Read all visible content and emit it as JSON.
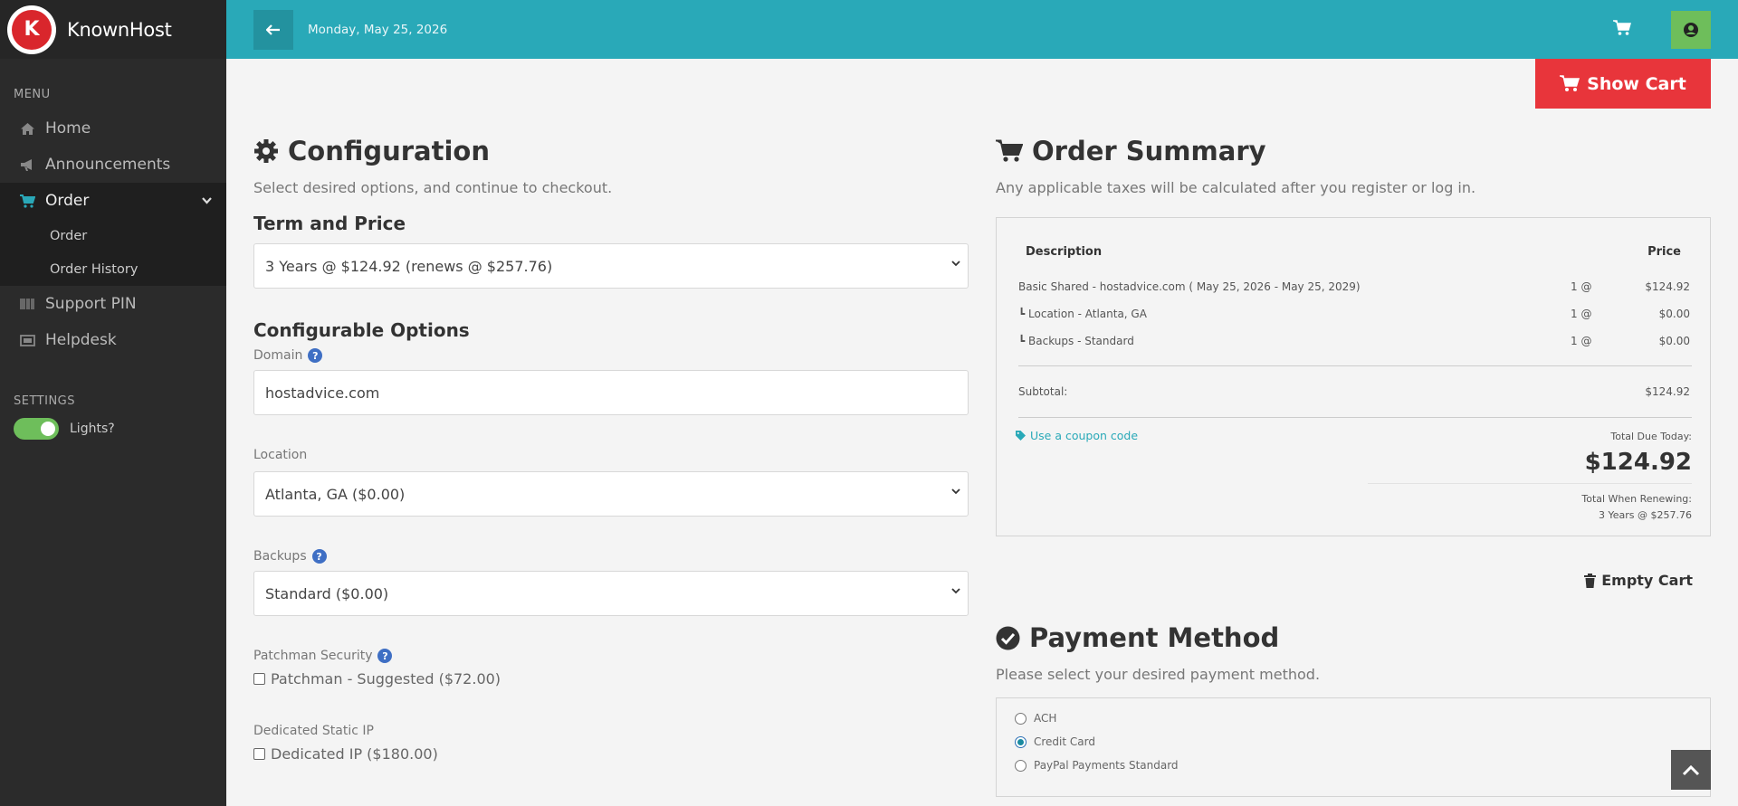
{
  "brand": {
    "name": "KnownHost"
  },
  "sidebar": {
    "menu_label": "MENU",
    "items": [
      {
        "label": "Home",
        "icon": "home-icon"
      },
      {
        "label": "Announcements",
        "icon": "bullhorn-icon"
      },
      {
        "label": "Order",
        "icon": "cart-icon"
      },
      {
        "label": "Support PIN",
        "icon": "barcode-icon"
      },
      {
        "label": "Helpdesk",
        "icon": "ticket-icon"
      }
    ],
    "sub_items": [
      {
        "label": "Order"
      },
      {
        "label": "Order History"
      }
    ],
    "settings_label": "SETTINGS",
    "lights_label": "Lights?"
  },
  "topbar": {
    "date": "Monday, May 25, 2026"
  },
  "show_cart": {
    "label": "Show Cart"
  },
  "config": {
    "title": "Configuration",
    "subtitle": "Select desired options, and continue to checkout.",
    "term_title": "Term and Price",
    "term_value": "3 Years @ $124.92 (renews @ $257.76)",
    "options_title": "Configurable Options",
    "domain_label": "Domain",
    "domain_value": "hostadvice.com",
    "location_label": "Location",
    "location_value": "Atlanta, GA ($0.00)",
    "backups_label": "Backups",
    "backups_value": "Standard ($0.00)",
    "patchman_label": "Patchman Security",
    "patchman_option": "Patchman - Suggested ($72.00)",
    "static_ip_label": "Dedicated Static IP",
    "static_ip_option": "Dedicated IP ($180.00)"
  },
  "summary": {
    "title": "Order Summary",
    "subtitle": "Any applicable taxes will be calculated after you register or log in.",
    "col_description": "Description",
    "col_price": "Price",
    "lines": [
      {
        "desc": "Basic Shared - hostadvice.com ( May 25, 2026 - May 25, 2029)",
        "qty": "1 @",
        "price": "$124.92"
      },
      {
        "desc": "┗ Location - Atlanta, GA",
        "qty": "1 @",
        "price": "$0.00"
      },
      {
        "desc": "┗ Backups - Standard",
        "qty": "1 @",
        "price": "$0.00"
      }
    ],
    "subtotal_label": "Subtotal:",
    "subtotal_value": "$124.92",
    "coupon_label": "Use a coupon code",
    "total_due_label": "Total Due Today:",
    "total_due_value": "$124.92",
    "renew_label": "Total When Renewing:",
    "renew_value": "3 Years @ $257.76",
    "empty_cart_label": "Empty Cart"
  },
  "payment": {
    "title": "Payment Method",
    "subtitle": "Please select your desired payment method.",
    "options": [
      {
        "label": "ACH",
        "selected": false
      },
      {
        "label": "Credit Card",
        "selected": true
      },
      {
        "label": "PayPal Payments Standard",
        "selected": false
      }
    ]
  },
  "colors": {
    "accent": "#29a9b8",
    "danger": "#e8353b",
    "success": "#6ebe5b",
    "sidebar": "#2b2b2b"
  }
}
